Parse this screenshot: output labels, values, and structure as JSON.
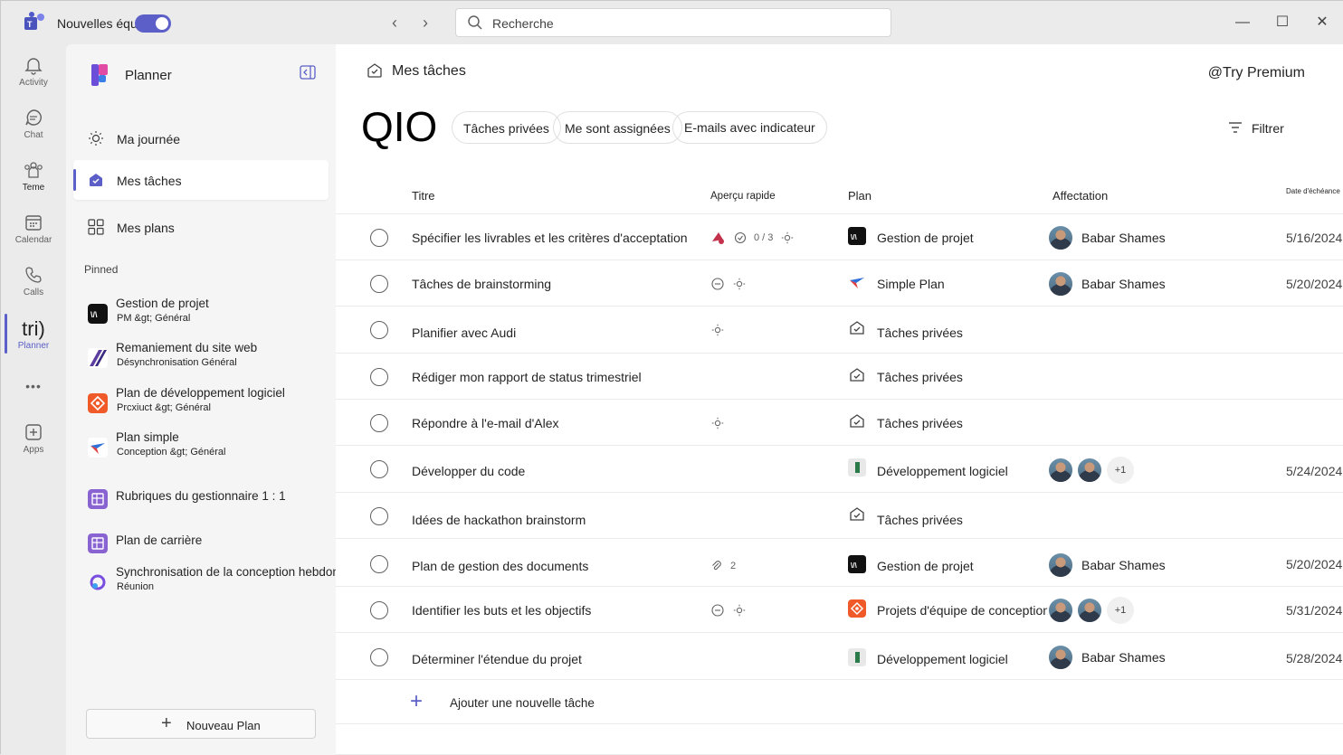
{
  "titlebar": {
    "app_name": "Nouvelles équipes",
    "search_placeholder": "Recherche",
    "back_arrow": "‹",
    "forward_arrow": "›",
    "minimize": "—",
    "maximize": "☐",
    "close": "✕"
  },
  "rail": {
    "items": [
      {
        "label": "Activity",
        "icon": "bell-icon"
      },
      {
        "label": "Chat",
        "icon": "chat-icon"
      },
      {
        "label": "Teme",
        "icon": "teams-icon"
      },
      {
        "label": "Calendar",
        "icon": "calendar-icon"
      },
      {
        "label": "Calls",
        "icon": "phone-icon"
      },
      {
        "label": "Planner",
        "icon_text": "tri)"
      },
      {
        "label": "•••",
        "icon": "more-icon"
      },
      {
        "label": "Apps",
        "icon": "apps-icon"
      }
    ]
  },
  "sidebar": {
    "title": "Planner",
    "nav": [
      {
        "label": "Ma journée",
        "icon": "sun-icon"
      },
      {
        "label": "Mes tâches",
        "icon": "my-tasks-icon",
        "active": true
      },
      {
        "label": "Mes plans",
        "icon": "grid-icon"
      }
    ],
    "pinned_header": "Pinned",
    "pinned": [
      {
        "title": "Gestion de projet",
        "sub": "PM &gt; Général"
      },
      {
        "title": "Remaniement du site web",
        "sub": "Désynchronisation  Général"
      },
      {
        "title": "Plan de développement logiciel",
        "sub": "Prcxiuct &gt; Général"
      },
      {
        "title": "Plan simple",
        "sub": "Conception &gt; Général"
      },
      {
        "title": "Rubriques du gestionnaire 1 : 1",
        "sub": ""
      },
      {
        "title": "Plan de carrière",
        "sub": ""
      },
      {
        "title": "Synchronisation de la conception hebdomadaire",
        "sub": "Réunion"
      }
    ],
    "new_plan_plus": "+",
    "new_plan_label": "Nouveau Plan"
  },
  "main": {
    "title": "Mes tâches",
    "premium": "@Try Premium",
    "big_text": "QIO",
    "pills": [
      "Tâches privées",
      "Me sont assignées",
      "E-mails avec indicateur"
    ],
    "filter_label": "Filtrer",
    "columns": {
      "title": "Titre",
      "apercu": "Aperçu rapide",
      "plan": "Plan",
      "assign": "Affectation",
      "due": "Date d'échéance"
    },
    "tasks": [
      {
        "title": "Spécifier les livrables et les critères d'acceptation",
        "checklist": "0 / 3",
        "plan": "Gestion de projet",
        "assignee": "Babar Shames",
        "date": "5/16/2024"
      },
      {
        "title": "Tâches de brainstorming",
        "plan": "Simple Plan",
        "assignee": "Babar Shames",
        "date": "5/20/2024"
      },
      {
        "title": "Planifier avec Audi",
        "plan": "Tâches privées",
        "assignee": "",
        "date": ""
      },
      {
        "title": "Rédiger mon rapport de status trimestriel",
        "plan": "Tâches privées",
        "assignee": "",
        "date": ""
      },
      {
        "title": "Répondre à l'e-mail d'Alex",
        "plan": "Tâches privées",
        "assignee": "",
        "date": ""
      },
      {
        "title": "Développer du code",
        "plan": "Développement logiciel",
        "extra": "+1",
        "date": "5/24/2024"
      },
      {
        "title": "Idées de hackathon brainstorm",
        "plan": "Tâches privées",
        "assignee": "",
        "date": ""
      },
      {
        "title": "Plan de gestion des documents",
        "attachments": "2",
        "plan": "Gestion de projet",
        "assignee": "Babar Shames",
        "date": "5/20/2024"
      },
      {
        "title": "Identifier les buts et les objectifs",
        "plan": "Projets d'équipe de conception",
        "extra": "+1",
        "date": "5/31/2024"
      },
      {
        "title": "Déterminer l'étendue du projet",
        "plan": "Développement logiciel",
        "assignee": "Babar Shames",
        "date": "5/28/2024"
      }
    ],
    "add_plus": "+",
    "add_label": "Ajouter une nouvelle tâche"
  },
  "colors": {
    "accent": "#5b5fc7",
    "rail_bg": "#ebebeb",
    "sidebar_bg": "#f5f5f5"
  }
}
